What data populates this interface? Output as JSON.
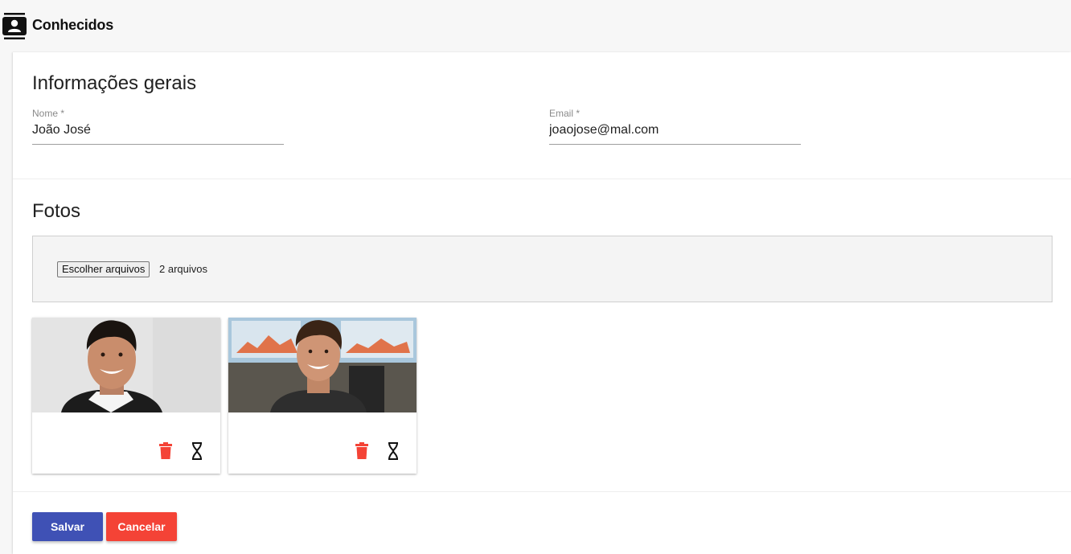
{
  "header": {
    "app_title": "Conhecidos",
    "icon": "contacts-icon"
  },
  "general_info": {
    "title": "Informações gerais",
    "name": {
      "label": "Nome *",
      "value": "João José"
    },
    "email": {
      "label": "Email *",
      "value": "joaojose@mal.com"
    }
  },
  "photos": {
    "title": "Fotos",
    "file_button_label": "Escolher arquivos",
    "file_count_text": "2 arquivos",
    "cards": [
      {
        "delete_icon": "trash-icon",
        "pending_icon": "hourglass-icon"
      },
      {
        "delete_icon": "trash-icon",
        "pending_icon": "hourglass-icon"
      }
    ]
  },
  "actions": {
    "save_label": "Salvar",
    "cancel_label": "Cancelar"
  },
  "colors": {
    "primary": "#3f51b5",
    "danger": "#f44336"
  }
}
